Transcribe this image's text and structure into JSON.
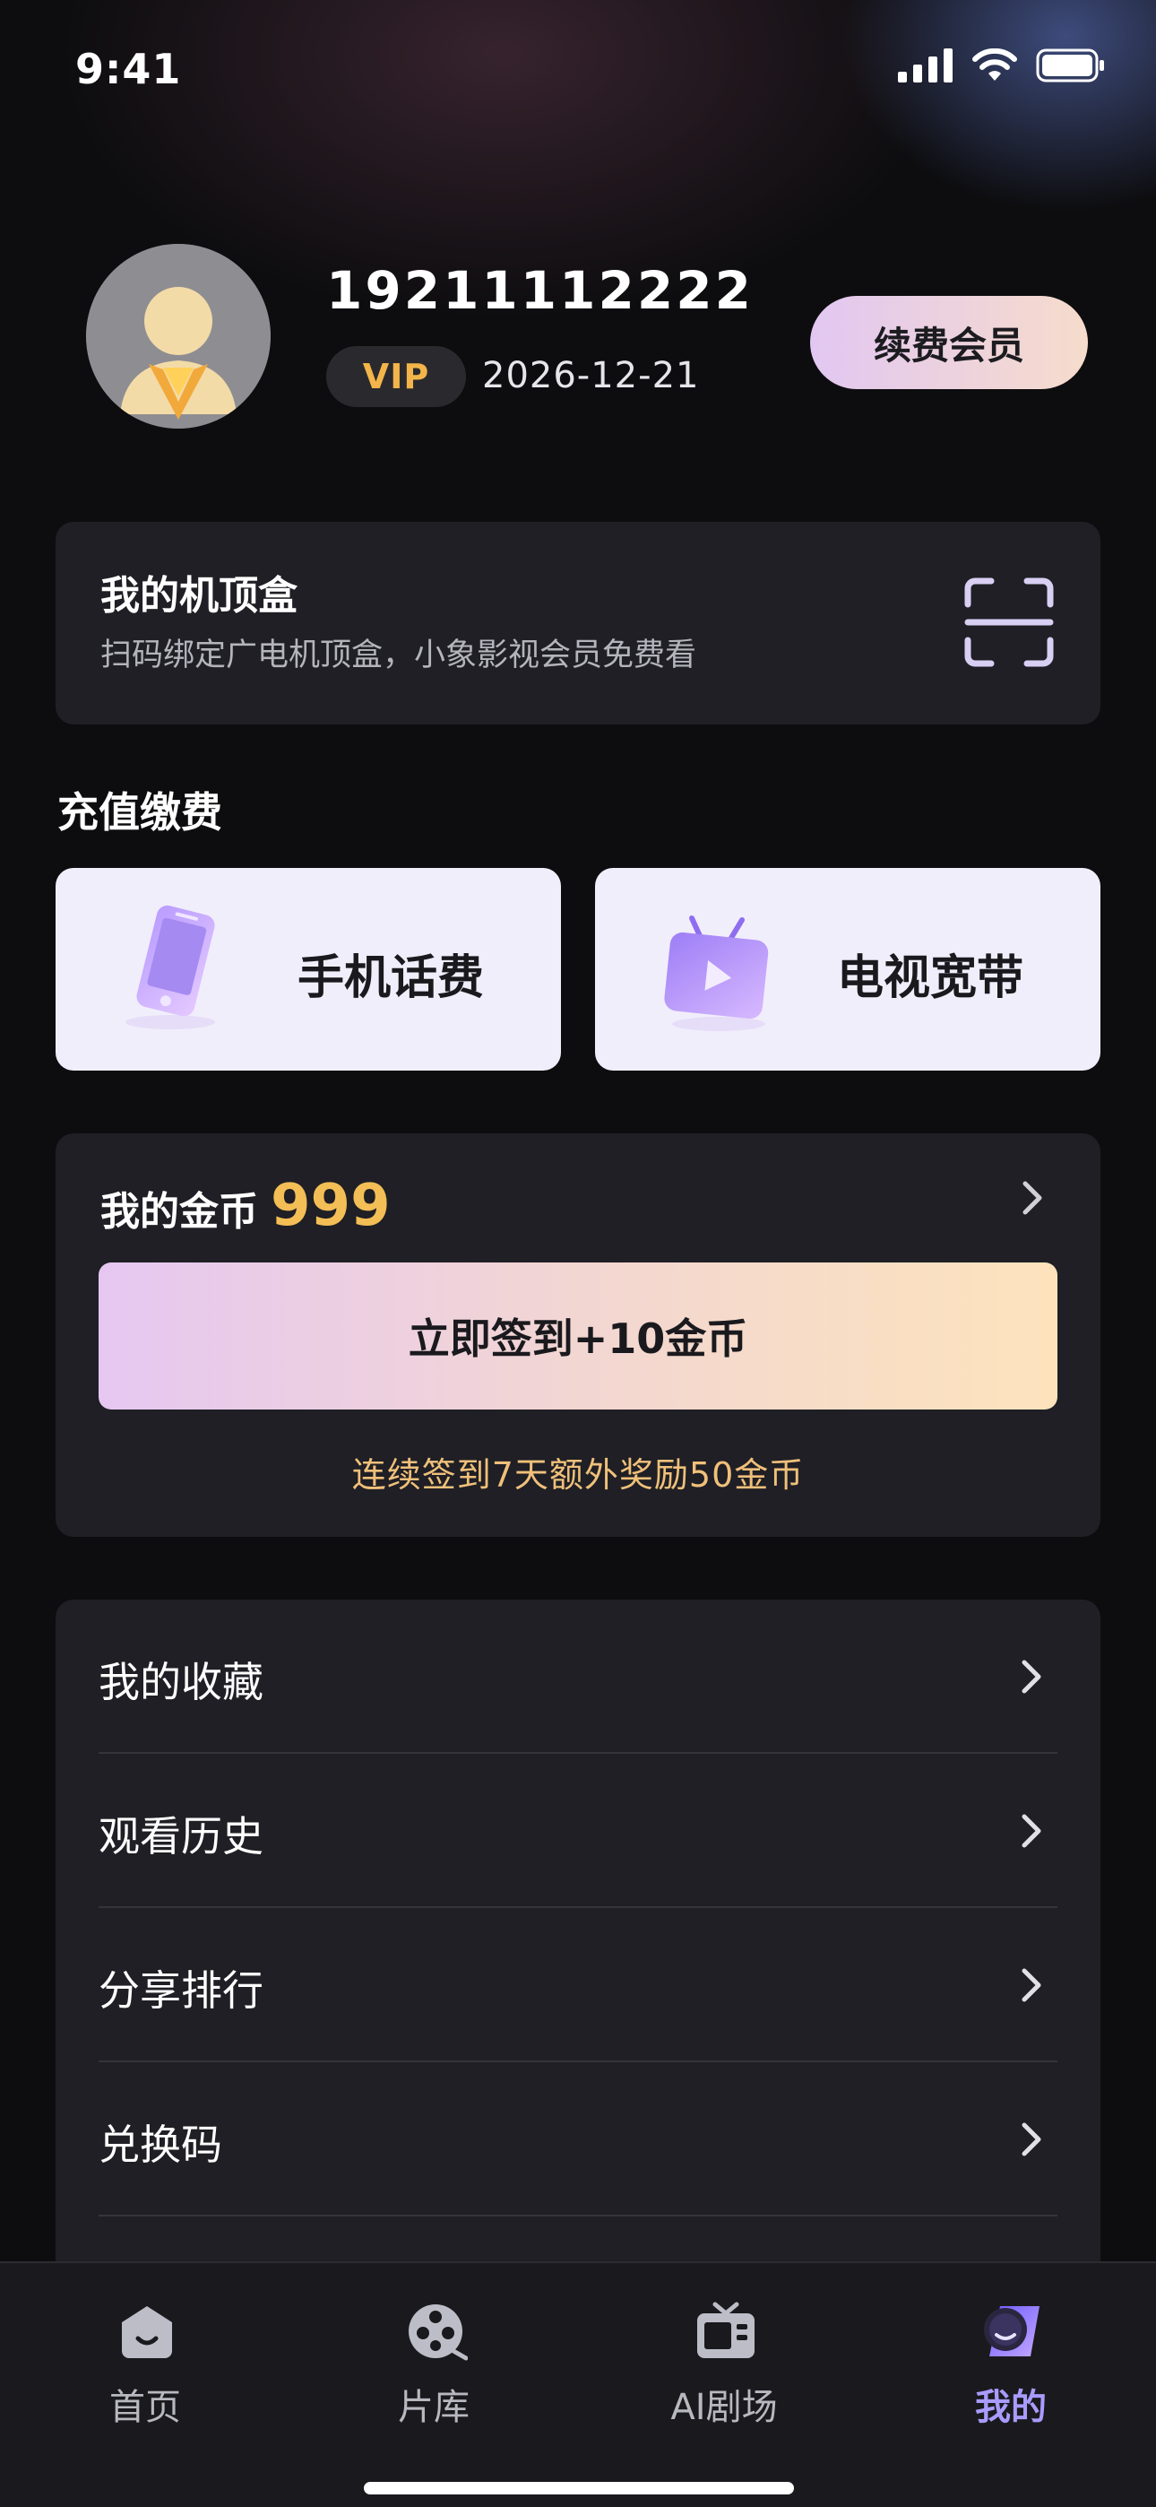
{
  "status": {
    "time": "9:41"
  },
  "profile": {
    "phone": "19211112222",
    "vip_badge": "VIP",
    "vip_expiry": "2026-12-21",
    "renew_label": "续费会员"
  },
  "set_top_box": {
    "title": "我的机顶盒",
    "subtitle": "扫码绑定广电机顶盒，小象影视会员免费看",
    "icon": "scan-icon"
  },
  "recharge": {
    "section_title": "充值缴费",
    "tiles": [
      {
        "label": "手机话费",
        "icon": "phone-icon"
      },
      {
        "label": "电视宽带",
        "icon": "tv-icon"
      }
    ]
  },
  "coins": {
    "label": "我的金币",
    "value": "999",
    "checkin_label": "立即签到+10金币",
    "tip": "连续签到7天额外奖励50金币"
  },
  "menu": [
    {
      "label": "我的收藏"
    },
    {
      "label": "观看历史"
    },
    {
      "label": "分享排行"
    },
    {
      "label": "兑换码"
    }
  ],
  "tabbar": {
    "tabs": [
      {
        "label": "首页",
        "icon": "home-icon"
      },
      {
        "label": "片库",
        "icon": "film-reel-icon"
      },
      {
        "label": "AI剧场",
        "icon": "ai-theater-icon"
      },
      {
        "label": "我的",
        "icon": "profile-icon"
      }
    ],
    "active_index": 3
  },
  "colors": {
    "background": "#0d0d0f",
    "card": "#1f1f25",
    "gold": "#f3be55",
    "accent": "#a99bff"
  }
}
